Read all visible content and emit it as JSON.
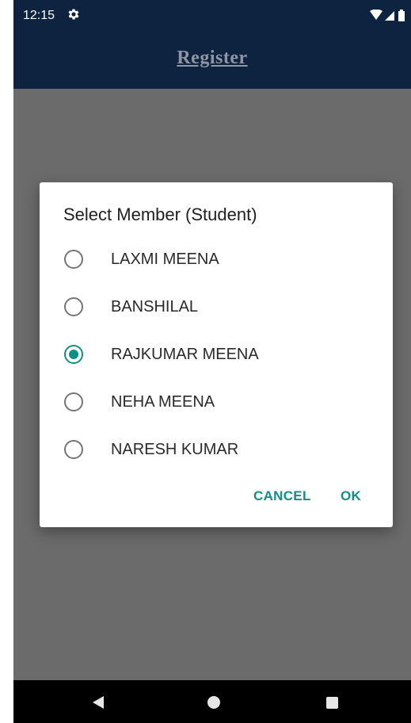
{
  "status_bar": {
    "time": "12:15",
    "icons": [
      "gear-icon",
      "wifi-icon",
      "signal-icon",
      "battery-icon"
    ]
  },
  "app_bar": {
    "title": "Register"
  },
  "dialog": {
    "title": "Select Member (Student)",
    "options": [
      {
        "label": "LAXMI MEENA",
        "selected": false
      },
      {
        "label": "BANSHILAL",
        "selected": false
      },
      {
        "label": "RAJKUMAR MEENA",
        "selected": true
      },
      {
        "label": "NEHA MEENA",
        "selected": false
      },
      {
        "label": "NARESH KUMAR",
        "selected": false
      }
    ],
    "cancel_label": "CANCEL",
    "ok_label": "OK"
  },
  "colors": {
    "accent": "#108f84",
    "app_bar": "#0e2340",
    "scrim": "#6b6b6b"
  },
  "nav_bar": {
    "icons": [
      "back-icon",
      "home-icon",
      "recents-icon"
    ]
  }
}
